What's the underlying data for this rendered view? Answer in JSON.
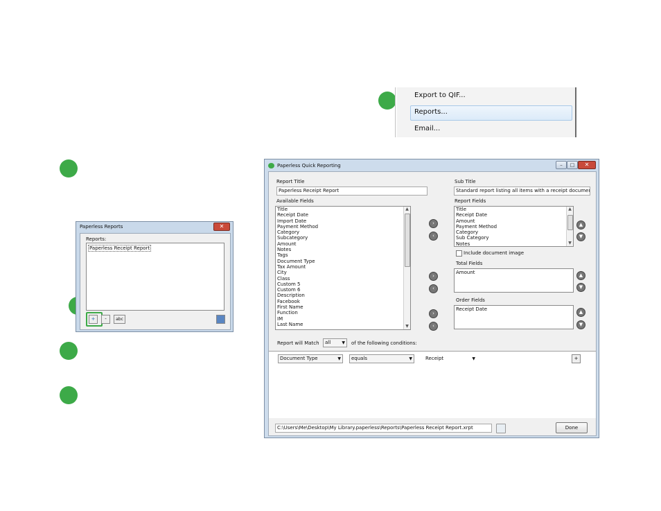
{
  "context_menu": {
    "items": [
      "Export to QIF...",
      "Reports...",
      "Email..."
    ]
  },
  "reports_window": {
    "title": "Paperless Reports",
    "reports_label": "Reports:",
    "reports": [
      "Paperless Receipt Report"
    ],
    "add_label": "+",
    "remove_label": "-",
    "rename_label": "abc"
  },
  "quick_reporting": {
    "title": "Paperless Quick Reporting",
    "report_title_label": "Report Title",
    "report_title_value": "Paperless Receipt Report",
    "sub_title_label": "Sub Title",
    "sub_title_value": "Standard report listing all items with a receipt document type",
    "available_fields_label": "Available Fields",
    "available_fields": [
      "Title",
      "Receipt Date",
      "Import Date",
      "Payment Method",
      "Category",
      "Subcategory",
      "Amount",
      "Notes",
      "Tags",
      "Document Type",
      "Tax Amount",
      "City",
      "Class",
      "Custom 5",
      "Custom 6",
      "Description",
      "Facebook",
      "First Name",
      "Function",
      "IM",
      "Last Name"
    ],
    "report_fields_label": "Report Fields",
    "report_fields": [
      "Title",
      "Receipt Date",
      "Amount",
      "Payment Method",
      "Category",
      "Sub Category",
      "Notes"
    ],
    "include_image_label": "Include document image",
    "total_fields_label": "Total Fields",
    "total_fields": [
      "Amount"
    ],
    "order_fields_label": "Order Fields",
    "order_fields": [
      "Receipt Date"
    ],
    "match_prefix": "Report will Match",
    "match_value": "all",
    "match_suffix": "of the following conditions:",
    "condition": {
      "field": "Document Type",
      "operator": "equals",
      "value": "Receipt",
      "add_label": "+"
    },
    "path_value": "C:\\Users\\Me\\Desktop\\My Library.paperless\\Reports\\Paperless Receipt Report.xrpt",
    "done_label": "Done"
  },
  "colors": {
    "step_marker": "#3daa48",
    "highlight_border": "#3daa48"
  }
}
